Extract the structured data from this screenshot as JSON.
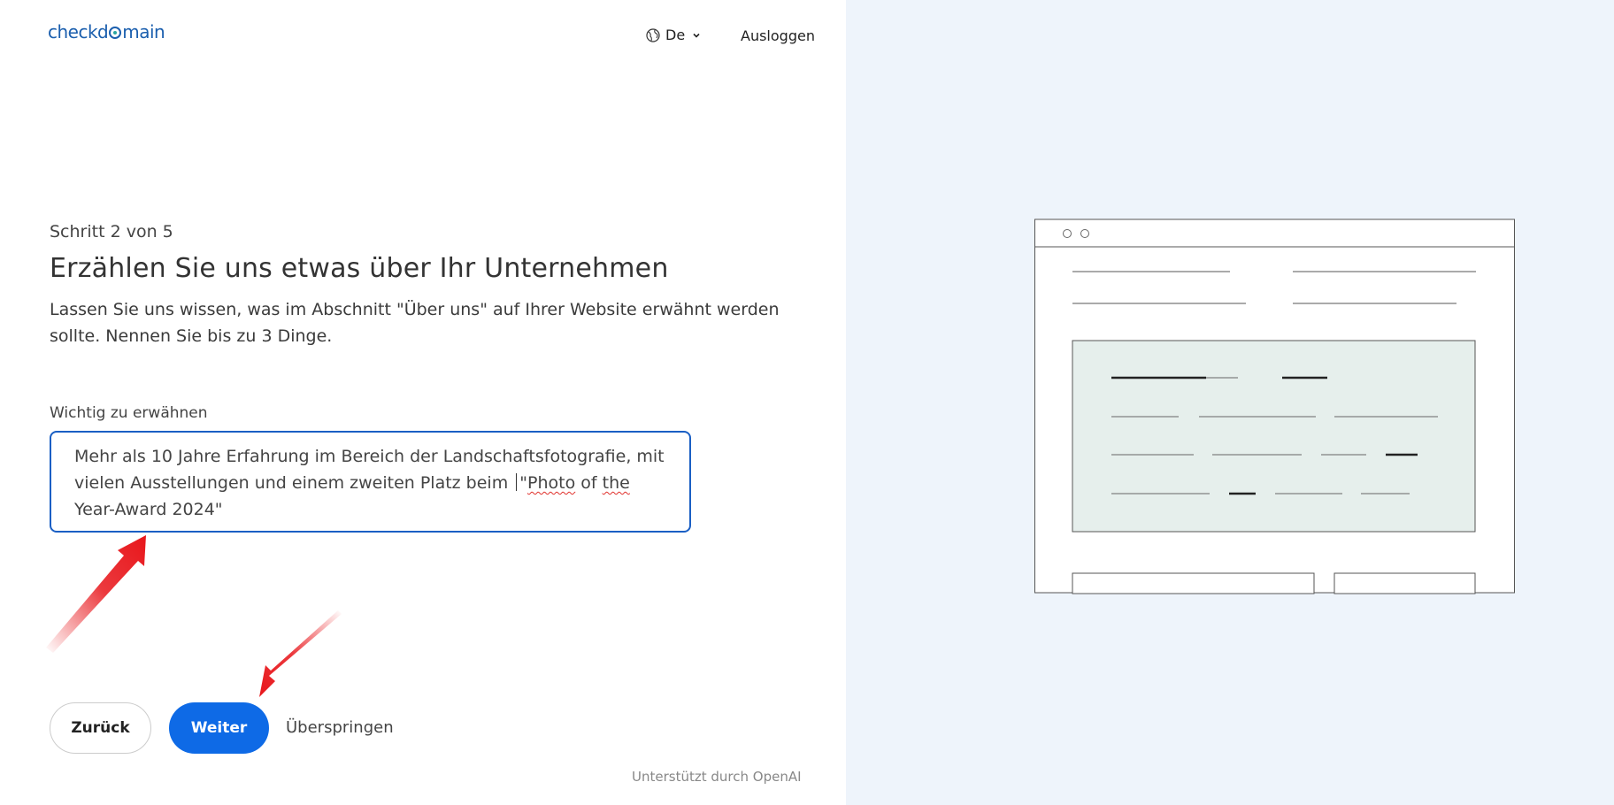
{
  "header": {
    "logo_text": "checkdomain",
    "language_label": "De",
    "logout_label": "Ausloggen"
  },
  "main": {
    "step_text": "Schritt 2 von 5",
    "title": "Erzählen Sie uns etwas über Ihr Unternehmen",
    "description": "Lassen Sie uns wissen, was im Abschnitt \"Über uns\" auf Ihrer Website erwähnt werden sollte. Nennen Sie bis zu 3 Dinge.",
    "field": {
      "label": "Wichtig zu erwähnen",
      "value_part1": "Mehr als 10 Jahre Erfahrung im Bereich der Landschaftsfotografie, mit vielen Ausstellungen und einem zweiten Platz beim ",
      "value_part2": "\"",
      "value_misspelled_1": "Photo",
      "value_between_1": " of ",
      "value_misspelled_2": "the",
      "value_part3": " Year-Award 2024\""
    }
  },
  "actions": {
    "back_label": "Zurück",
    "next_label": "Weiter",
    "skip_label": "Überspringen"
  },
  "footer": {
    "powered_by": "Unterstützt durch OpenAI"
  },
  "colors": {
    "accent": "#0e6ae6",
    "field_border": "#1a5fc4",
    "right_panel_bg": "#eef4fb",
    "illustration_panel": "#e6efec",
    "annotation_arrow": "#e8161b"
  }
}
